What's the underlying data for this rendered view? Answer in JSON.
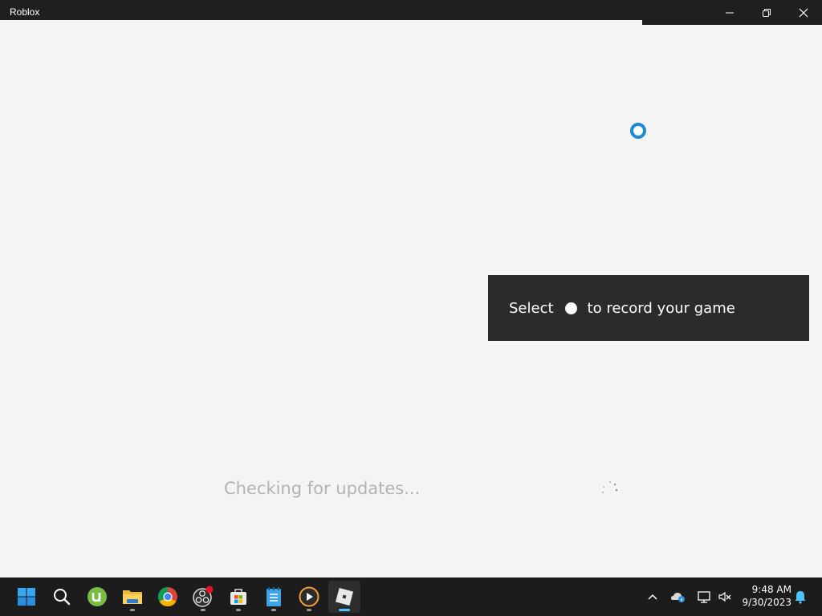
{
  "window": {
    "title": "Roblox"
  },
  "toast": {
    "prefix": "Select",
    "suffix": "to record your game",
    "icon": "record-dot"
  },
  "loader": {
    "status": "Checking for updates..."
  },
  "taskbar": {
    "apps": [
      {
        "name": "start",
        "icon": "windows-logo-icon"
      },
      {
        "name": "search",
        "icon": "search-icon"
      },
      {
        "name": "utorrent",
        "icon": "utorrent-icon"
      },
      {
        "name": "file-explorer",
        "icon": "folder-icon"
      },
      {
        "name": "chrome",
        "icon": "chrome-icon"
      },
      {
        "name": "obs",
        "icon": "obs-icon"
      },
      {
        "name": "microsoft-store",
        "icon": "store-icon"
      },
      {
        "name": "notepad",
        "icon": "notepad-icon"
      },
      {
        "name": "media-player",
        "icon": "media-player-icon"
      },
      {
        "name": "roblox",
        "icon": "roblox-icon"
      }
    ],
    "clock": {
      "time": "9:48 AM",
      "date": "9/30/2023"
    }
  },
  "colors": {
    "accent": "#1e8ad6",
    "toast_bg": "#2b2b2b",
    "taskbar_bg": "#1c1c1c",
    "active_indicator": "#4cc2ff"
  }
}
